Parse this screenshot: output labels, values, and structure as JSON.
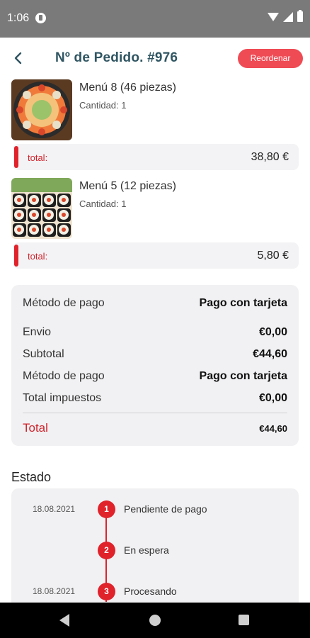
{
  "status_bar": {
    "time": "1:06",
    "icons": [
      "notification-icon",
      "wifi-icon",
      "signal-icon",
      "battery-icon"
    ]
  },
  "header": {
    "back_icon": "arrow-left-icon",
    "title": "Nº de Pedido. #976",
    "reorder_label": "Reordenar"
  },
  "colors": {
    "accent": "#e0222b",
    "title": "#2f5562",
    "button": "#ef4b55"
  },
  "items": [
    {
      "name": "Menú 8 (46 piezas)",
      "quantity": "Cantidad: 1",
      "total_label": "total:",
      "total_value": "38,80 €",
      "image": "sushi-platter-image"
    },
    {
      "name": "Menú 5 (12 piezas)",
      "quantity": "Cantidad: 1",
      "total_label": "total:",
      "total_value": "5,80 €",
      "image": "sushi-rolls-image"
    }
  ],
  "summary": {
    "payment_label": "Método de pago",
    "payment_value": "Pago con tarjeta",
    "shipping_label": "Envio",
    "shipping_value": "€0,00",
    "subtotal_label": "Subtotal",
    "subtotal_value": "€44,60",
    "payment2_label": "Método de pago",
    "payment2_value": "Pago con tarjeta",
    "tax_label": "Total impuestos",
    "tax_value": "€0,00",
    "total_label": "Total",
    "total_value": "€44,60"
  },
  "estado": {
    "title": "Estado",
    "steps": [
      {
        "date": "18.08.2021",
        "number": "1",
        "status": "Pendiente de pago"
      },
      {
        "date": "",
        "number": "2",
        "status": "En espera"
      },
      {
        "date": "18.08.2021",
        "number": "3",
        "status": "Procesando"
      }
    ]
  },
  "nav_bar": {
    "icons": [
      "nav-back-icon",
      "nav-home-icon",
      "nav-recents-icon"
    ]
  }
}
